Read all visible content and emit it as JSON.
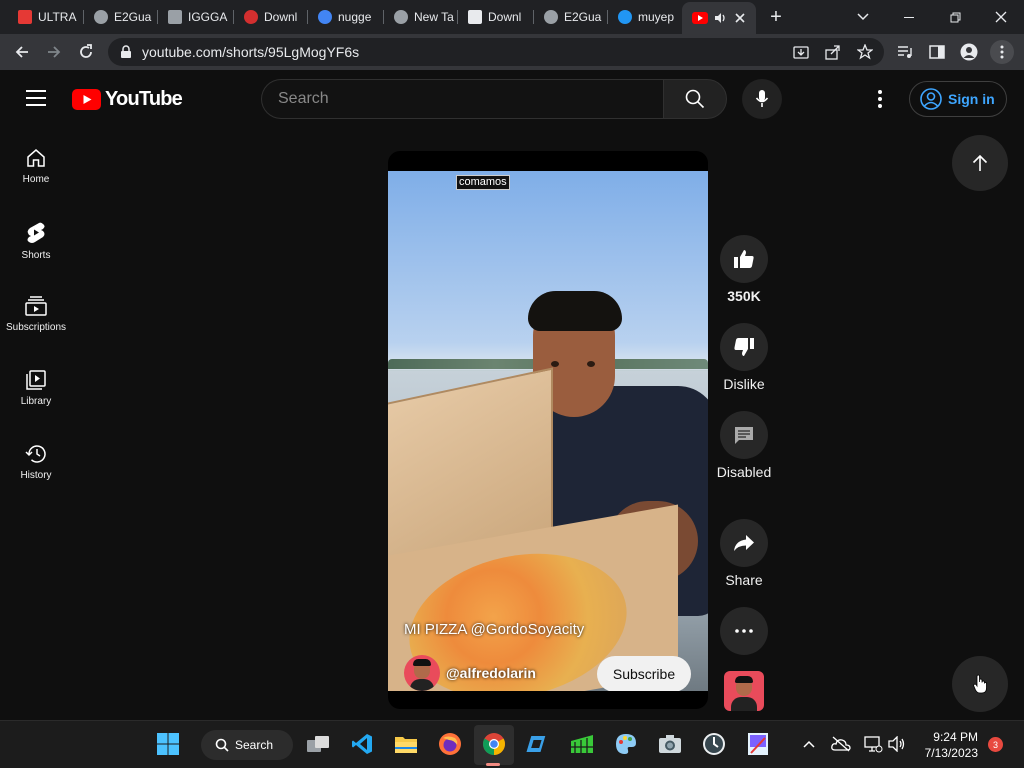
{
  "tabs": [
    {
      "label": "ULTRA",
      "color": "#e53935"
    },
    {
      "label": "E2Gua",
      "color": "#9aa0a6"
    },
    {
      "label": "IGGGA",
      "color": "#9aa0a6"
    },
    {
      "label": "Downl",
      "color": "#d32f2f"
    },
    {
      "label": "nugge",
      "color": "#4285f4"
    },
    {
      "label": "New Ta",
      "color": "#9aa0a6"
    },
    {
      "label": "Downl",
      "color": "#e8eaed"
    },
    {
      "label": "E2Gua",
      "color": "#9aa0a6"
    },
    {
      "label": "muyep",
      "color": "#2196f3"
    }
  ],
  "address": {
    "url": "youtube.com/shorts/95LgMogYF6s"
  },
  "youtube": {
    "logo_text": "YouTube",
    "search_placeholder": "Search",
    "sign_in": "Sign in",
    "nav": [
      {
        "label": "Home",
        "icon": "home-icon"
      },
      {
        "label": "Shorts",
        "icon": "shorts-icon"
      },
      {
        "label": "Subscriptions",
        "icon": "subscriptions-icon"
      },
      {
        "label": "Library",
        "icon": "library-icon"
      },
      {
        "label": "History",
        "icon": "history-icon"
      }
    ],
    "short": {
      "caption_overlay": "comamos",
      "title": "MI PIZZA @GordoSoyacity",
      "channel": "@alfredolarin",
      "subscribe": "Subscribe"
    },
    "actions": {
      "like_count": "350K",
      "dislike": "Dislike",
      "comments": "Disabled",
      "share": "Share"
    }
  },
  "taskbar": {
    "search_label": "Search",
    "time": "9:24 PM",
    "date": "7/13/2023",
    "notification_count": "3"
  },
  "colors": {
    "brand_red": "#ff0000",
    "link_blue": "#3ea6ff"
  }
}
